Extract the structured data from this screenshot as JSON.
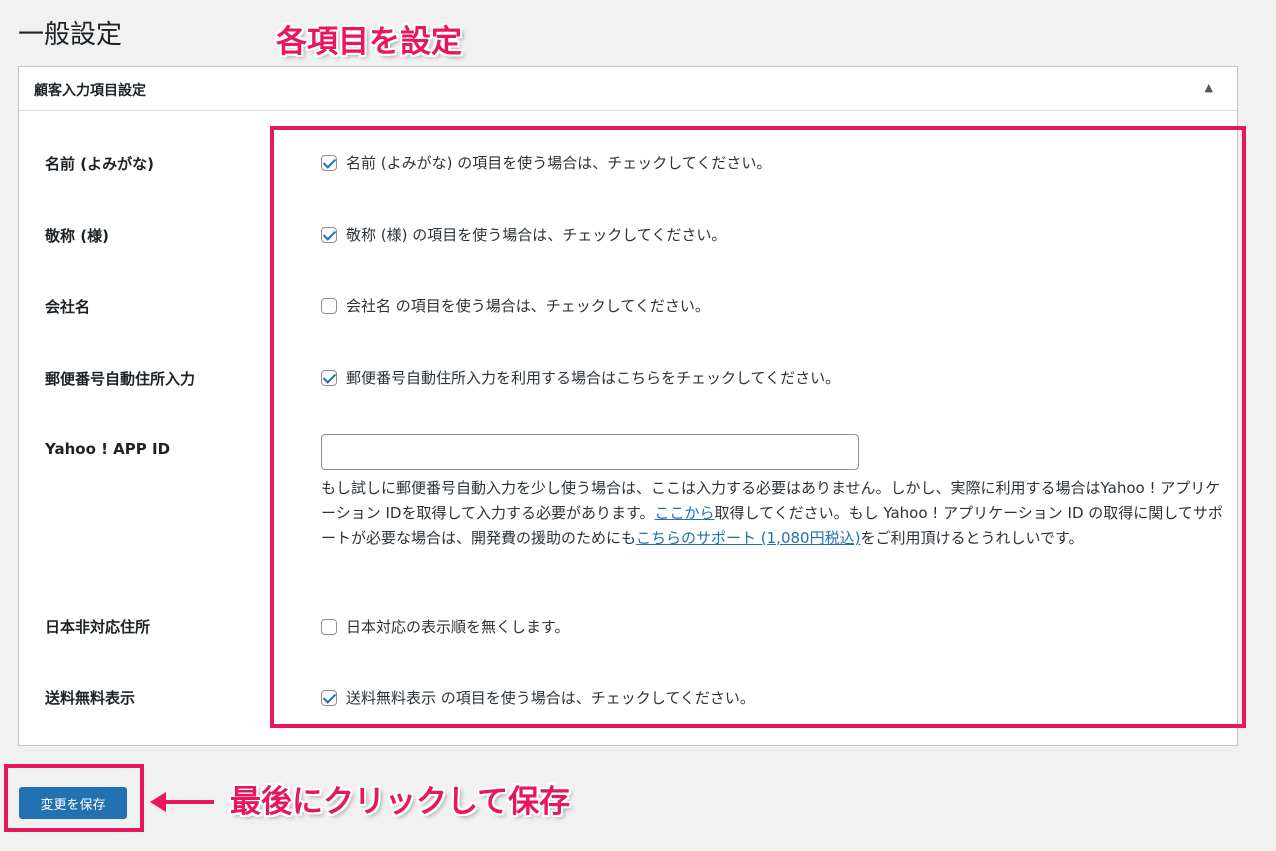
{
  "page": {
    "title": "一般設定"
  },
  "panel": {
    "title": "顧客入力項目設定",
    "toggle_icon": "▲"
  },
  "rows": [
    {
      "label": "名前 (よみがな)",
      "checked": true,
      "text": "名前 (よみがな) の項目を使う場合は、チェックしてください。"
    },
    {
      "label": "敬称 (様)",
      "checked": true,
      "text": "敬称 (様) の項目を使う場合は、チェックしてください。"
    },
    {
      "label": "会社名",
      "checked": false,
      "text": "会社名 の項目を使う場合は、チェックしてください。"
    },
    {
      "label": "郵便番号自動住所入力",
      "checked": true,
      "text": "郵便番号自動住所入力を利用する場合はこちらをチェックしてください。"
    },
    {
      "label": "日本非対応住所",
      "checked": false,
      "text": "日本対応の表示順を無くします。"
    },
    {
      "label": "送料無料表示",
      "checked": true,
      "text": "送料無料表示 の項目を使う場合は、チェックしてください。"
    }
  ],
  "yahoo": {
    "label": "Yahoo ! APP ID",
    "value": "",
    "desc_part1": "もし試しに郵便番号自動入力を少し使う場合は、ここは入力する必要はありません。しかし、実際に利用する場合はYahoo ! アプリケーション IDを取得して入力する必要があります。",
    "link1": "ここから",
    "desc_part2": "取得してください。もし Yahoo ! アプリケーション ID の取得に関してサポートが必要な場合は、開発費の援助のためにも",
    "link2": "こちらのサポート (1,080円税込)",
    "desc_part3": "をご利用頂けるとうれしいです。"
  },
  "save_button": "変更を保存",
  "annotations": {
    "top": "各項目を設定",
    "bottom": "最後にクリックして保存",
    "color": "#e8175d"
  },
  "colors": {
    "primary": "#2271b1",
    "annotation": "#e8175d"
  }
}
